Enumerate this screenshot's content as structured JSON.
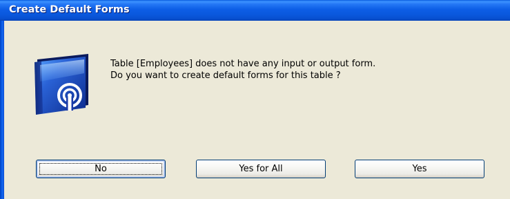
{
  "window": {
    "title": "Create Default Forms"
  },
  "message": {
    "line1": "Table [Employees] does not have any input or output form.",
    "line2": "Do you want to create default forms for this table ?"
  },
  "icon": {
    "name": "app-broadcast-icon",
    "colors": {
      "body": "#1e3fb8",
      "highlight": "#9fd0ff",
      "ring": "#ffffff"
    }
  },
  "buttons": {
    "no_label": "No",
    "yes_for_all_label": "Yes for All",
    "yes_label": "Yes"
  },
  "colors": {
    "titlebar": "#0a58dd",
    "dialog_background": "#ece9d8",
    "button_border": "#003c74"
  }
}
